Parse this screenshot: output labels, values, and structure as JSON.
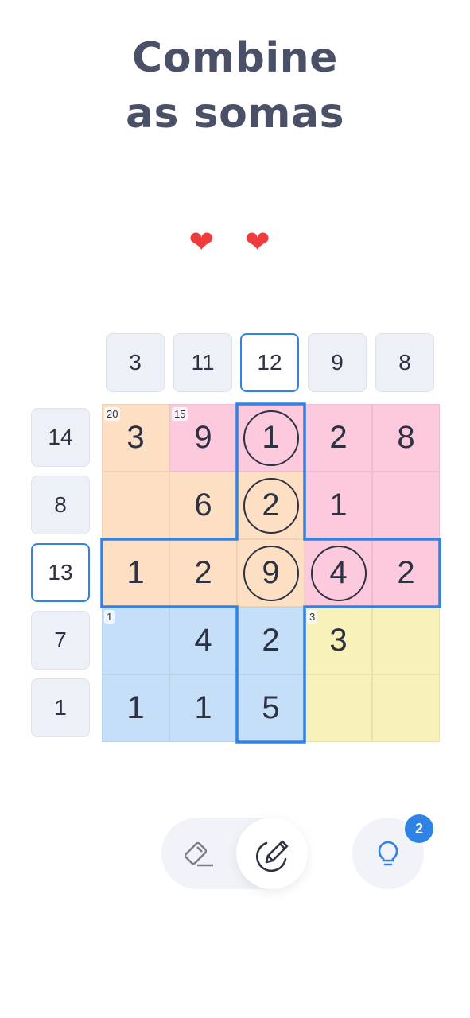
{
  "title_line1": "Combine",
  "title_line2": "as somas",
  "lives": {
    "hearts": "❤ ❤",
    "count": 2
  },
  "column_clues": [
    "3",
    "11",
    "12",
    "9",
    "8"
  ],
  "selected_column": 2,
  "row_clues": [
    "14",
    "8",
    "13",
    "7",
    "1"
  ],
  "selected_row": 2,
  "colors": {
    "orange": "#fde0c4",
    "pink": "#fcc9dd",
    "blue": "#c6dff9",
    "yellow": "#f8f1ba",
    "accent": "#2f82e6"
  },
  "grid": {
    "regions": [
      [
        "orange",
        "pink",
        "pink",
        "pink",
        "pink"
      ],
      [
        "orange",
        "orange",
        "orange",
        "pink",
        "pink"
      ],
      [
        "orange",
        "orange",
        "orange",
        "pink",
        "pink"
      ],
      [
        "blue",
        "blue",
        "blue",
        "yellow",
        "yellow"
      ],
      [
        "blue",
        "blue",
        "blue",
        "yellow",
        "yellow"
      ]
    ],
    "cells": [
      [
        "3",
        "9",
        "1",
        "2",
        "8"
      ],
      [
        "",
        "6",
        "2",
        "1",
        ""
      ],
      [
        "1",
        "2",
        "9",
        "4",
        "2"
      ],
      [
        "",
        "4",
        "2",
        "3",
        ""
      ],
      [
        "1",
        "1",
        "5",
        "",
        ""
      ]
    ],
    "circled": [
      [
        0,
        2
      ],
      [
        1,
        2
      ],
      [
        2,
        2
      ],
      [
        2,
        3
      ]
    ],
    "cage_sums": [
      {
        "row": 0,
        "col": 0,
        "sum": "20"
      },
      {
        "row": 0,
        "col": 1,
        "sum": "15"
      },
      {
        "row": 3,
        "col": 0,
        "sum": "1"
      },
      {
        "row": 3,
        "col": 3,
        "sum": "3"
      }
    ]
  },
  "controls": {
    "eraser": "eraser-icon",
    "pencil": "pencil-icon",
    "pencil_active": true,
    "hint": "lightbulb-icon",
    "hint_count": "2"
  }
}
